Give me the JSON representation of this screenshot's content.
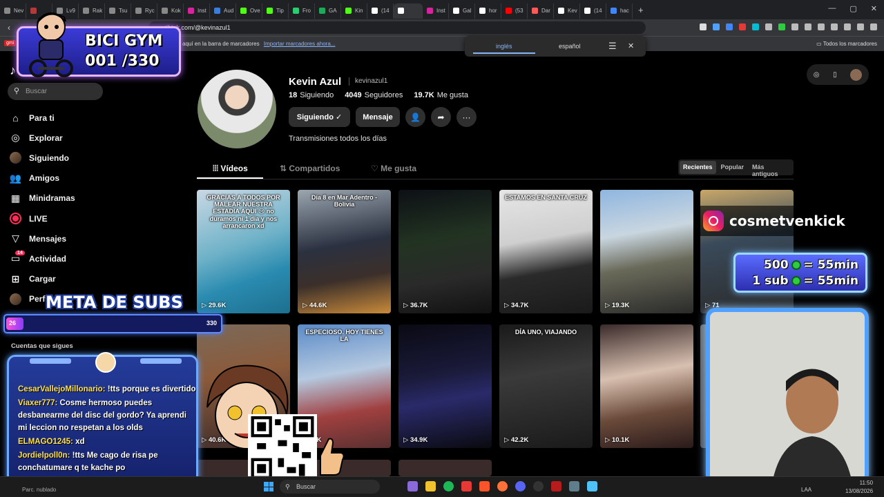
{
  "browser": {
    "tabs": [
      {
        "label": "Nev",
        "color": "#888888"
      },
      {
        "label": "",
        "color": "#b33a3a"
      },
      {
        "label": "Lv9",
        "color": "#888888"
      },
      {
        "label": "Rak",
        "color": "#888888"
      },
      {
        "label": "Tsu",
        "color": "#888888"
      },
      {
        "label": "Ryc",
        "color": "#888888"
      },
      {
        "label": "Kok",
        "color": "#888888"
      },
      {
        "label": "Inst",
        "color": "#d6249f"
      },
      {
        "label": "Aud",
        "color": "#3b7dd8"
      },
      {
        "label": "Ove",
        "color": "#53fc18"
      },
      {
        "label": "Tip",
        "color": "#53fc18"
      },
      {
        "label": "Fro",
        "color": "#2ecc71"
      },
      {
        "label": "GA",
        "color": "#1faa59"
      },
      {
        "label": "Kin",
        "color": "#53fc18"
      },
      {
        "label": "(14",
        "color": "#ffffff"
      },
      {
        "label": "",
        "color": "#ffffff"
      },
      {
        "label": "Inst",
        "color": "#d6249f"
      },
      {
        "label": "Gal",
        "color": "#ffffff"
      },
      {
        "label": "hor",
        "color": "#ffffff"
      },
      {
        "label": "(53",
        "color": "#ff0000"
      },
      {
        "label": "Dar",
        "color": "#ff5a5a"
      },
      {
        "label": "Kev",
        "color": "#ffffff"
      },
      {
        "label": "(14",
        "color": "#ffffff"
      },
      {
        "label": "hac",
        "color": "#4285f4"
      }
    ],
    "active_tab_index": 15,
    "new_tab": "+",
    "url": "tiktok.com/@kevinazul1",
    "bookmarks_hint": "aquí en la barra de marcadores",
    "bookmarks_link": "Importar marcadores ahora...",
    "bookmarks_all": "Todos los marcadores",
    "bookmark_gm": "gmi",
    "translate": {
      "lang1": "inglés",
      "lang2": "español"
    }
  },
  "sidebar": {
    "search_placeholder": "Buscar",
    "items": [
      {
        "label": "Para ti",
        "icon": "home-icon",
        "glyph": "⌂"
      },
      {
        "label": "Explorar",
        "icon": "compass-icon",
        "glyph": "◎"
      },
      {
        "label": "Siguiendo",
        "icon": "avatar-icon",
        "glyph": ""
      },
      {
        "label": "Amigos",
        "icon": "friends-icon",
        "glyph": "👥"
      },
      {
        "label": "Minidramas",
        "icon": "film-icon",
        "glyph": "▦"
      },
      {
        "label": "LIVE",
        "icon": "live-icon",
        "glyph": ""
      },
      {
        "label": "Mensajes",
        "icon": "send-icon",
        "glyph": "▽"
      },
      {
        "label": "Actividad",
        "icon": "bell-icon",
        "glyph": "▭",
        "badge": "14"
      },
      {
        "label": "Cargar",
        "icon": "plus-icon",
        "glyph": "⊞"
      },
      {
        "label": "Perfil",
        "icon": "profile-icon",
        "glyph": ""
      }
    ],
    "following_title": "Cuentas que sigues"
  },
  "profile": {
    "name": "Kevin Azul",
    "handle": "kevinazul1",
    "following_count": "18",
    "following_label": "Siguiendo",
    "followers_count": "4049",
    "followers_label": "Seguidores",
    "likes_count": "19.7K",
    "likes_label": "Me gusta",
    "btn_following": "Siguiendo ✓",
    "btn_message": "Mensaje",
    "bio": "Transmisiones todos los días",
    "tabs": {
      "videos": "Vídeos",
      "shared": "Compartidos",
      "likes": "Me gusta"
    },
    "sort": {
      "recent": "Recientes",
      "popular": "Popular",
      "oldest": "Más antiguos"
    }
  },
  "videos": [
    {
      "views": "29.6K",
      "caption": "GRACIAS A TODOS POR MALEAR NUESTRA ESTADIA AQUI 😢 no duramos ni 1 dia y nos arrancaron xd",
      "bg": "linear-gradient(160deg,#c9d8e4,#6fb2c8 45%,#2a8bb0 70%,#1d6f8e)"
    },
    {
      "views": "44.6K",
      "caption": "Día 8 en Mar Adentro - Bolivia",
      "bg": "linear-gradient(170deg,#9aa6b0,#2b3140 45%,#3b2f2a 70%,#c98a3a)"
    },
    {
      "views": "36.7K",
      "caption": "",
      "bg": "linear-gradient(170deg,#0d1015,#223322 40%,#2a2a2a 70%,#111)"
    },
    {
      "views": "34.7K",
      "caption": "ESTAMOS EN SANTA CRUZ",
      "bg": "linear-gradient(170deg,#e6e6e6,#cfcfcf 40%,#2a2a2a 65%,#1a1a1a)"
    },
    {
      "views": "19.3K",
      "caption": "",
      "bg": "linear-gradient(170deg,#8fb6e0,#c9d6e0 35%,#6a6a5a 60%,#2a2a2a)"
    },
    {
      "views": "71",
      "caption": "",
      "bg": "linear-gradient(170deg,#c9a86a,#3a4a5a 40%,#2a2a2a)"
    },
    {
      "views": "40.6K",
      "caption": "",
      "bg": "linear-gradient(170deg,#7a6a5a,#8b5a3a 40%,#3a2a2a)"
    },
    {
      "views": "79K",
      "caption": "ESPECIOSO. HOY TIENES LA",
      "bg": "linear-gradient(170deg,#5a8ac8,#b5c9e0 40%,#a04040 70%,#5a3030)"
    },
    {
      "views": "34.9K",
      "caption": "",
      "bg": "linear-gradient(170deg,#0a0a14,#1a1a3a 40%,#2a2a6a 60%,#0a0a10)"
    },
    {
      "views": "42.2K",
      "caption": "DÍA UNO, VIAJANDO",
      "bg": "linear-gradient(170deg,#1a1a1a,#3a3a3a 40%,#1a1a1a)"
    },
    {
      "views": "10.1K",
      "caption": "",
      "bg": "linear-gradient(170deg,#3a2a2a,#d8c0b0 40%,#6a4a3a 70%,#2a1a1a)"
    },
    {
      "views": "",
      "caption": "",
      "bg": "linear-gradient(170deg,#6a6a6a,#4a4a4a)"
    }
  ],
  "overlays": {
    "bicigym_title": "BICI GYM",
    "bicigym_count": "001 /330",
    "instagram_handle": "cosmetvenkick",
    "kick_goal_1": "500",
    "kick_goal_1_value": "= 55min",
    "kick_goal_2": "1 sub",
    "kick_goal_2_value": "= 55min",
    "meta_subs_title": "META DE SUBS",
    "subs_current": "26",
    "subs_max": "330",
    "subs_progress": 0.08
  },
  "chat": [
    {
      "user": "CesarVallejoMillonario:",
      "color": "#ffe14d",
      "text": "!tts porque es divertido"
    },
    {
      "user": "Viaxer777:",
      "color": "#ffe14d",
      "text": "Cosme hermoso puedes desbanearme del disc del gordo? Ya aprendi mi leccion no respetan a los olds"
    },
    {
      "user": "ELMAGO1245:",
      "color": "#ffe14d",
      "text": "xd"
    },
    {
      "user": "Jordielpoll0n:",
      "color": "#ffe14d",
      "text": "!tts Me cago de risa pe conchatumare q te kache po"
    }
  ],
  "taskbar": {
    "search_placeholder": "Buscar",
    "status_left": "Parc. nublado",
    "lang": "LAA",
    "time": "11:50",
    "date": "13/08/2026"
  }
}
